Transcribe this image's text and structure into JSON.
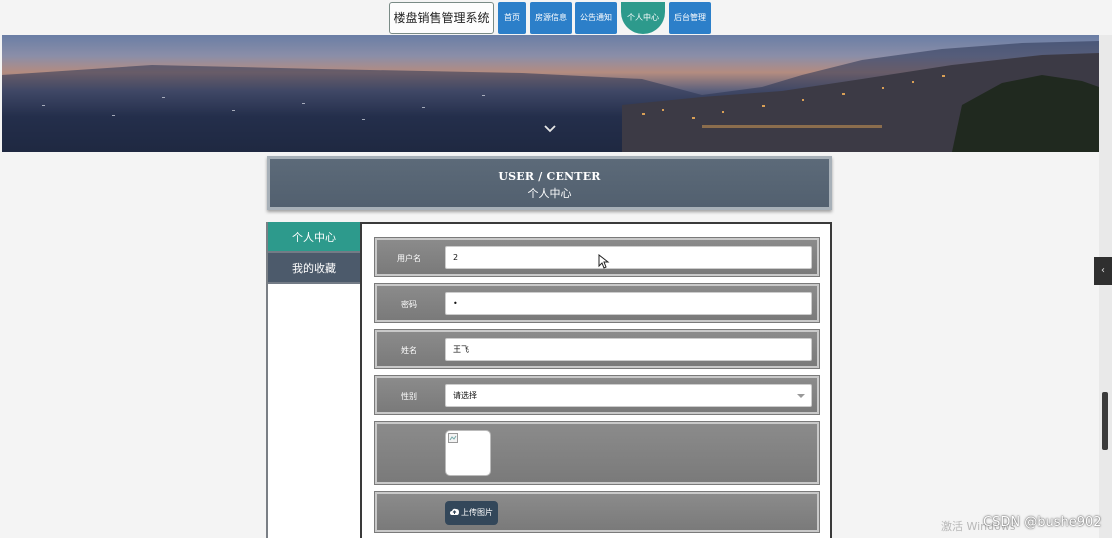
{
  "nav": {
    "brand": "楼盘销售管理系统",
    "items": [
      {
        "label": "首页"
      },
      {
        "label": "房源信息"
      },
      {
        "label": "公告通知"
      },
      {
        "label": "个人中心",
        "active": true
      },
      {
        "label": "后台管理"
      }
    ]
  },
  "page": {
    "title_en": "USER / CENTER",
    "title_cn": "个人中心"
  },
  "side_menu": [
    {
      "label": "个人中心",
      "active": true
    },
    {
      "label": "我的收藏"
    }
  ],
  "form": {
    "username_label": "用户名",
    "username_value": "2",
    "password_label": "密码",
    "password_value": "•",
    "name_label": "姓名",
    "name_value": "王飞",
    "gender_label": "性别",
    "gender_value": "请选择",
    "upload_label": "上传图片"
  },
  "watermark": {
    "windows": "激活 Windows",
    "csdn": "CSDN @bushe902"
  },
  "colors": {
    "nav_blue": "#2c7fc9",
    "accent_teal": "#2d9a8c",
    "menu_slate": "#4c5a6b"
  }
}
